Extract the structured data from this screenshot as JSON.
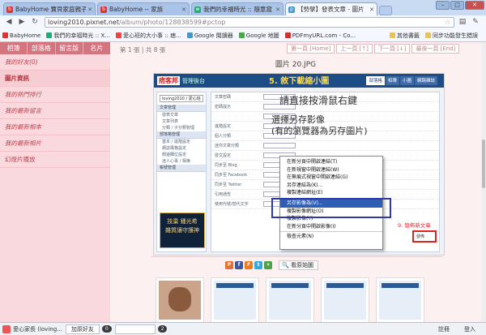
{
  "browser": {
    "tabs": [
      {
        "label": "BabyHome 寶貝家庭親子網",
        "favicon": "b",
        "active": false
      },
      {
        "label": "BabyHome -- 家族",
        "favicon": "b",
        "active": false
      },
      {
        "label": "我們的幸福時光 :: 隨意窩",
        "favicon": "w",
        "active": false
      },
      {
        "label": "【勢擘】發表文章 - 圖片",
        "favicon": "p",
        "active": true
      }
    ],
    "url_host": "loving2010.pixnet.net",
    "url_path": "/album/photo/128838599#pctop",
    "bookmarks": [
      {
        "label": "BabyHome",
        "color": "#d33"
      },
      {
        "label": "我們的幸福時光 :: X...",
        "color": "#2a7"
      },
      {
        "label": "愛心班的大小事 :: 痞...",
        "color": "#e44"
      },
      {
        "label": "Google 閱讀器",
        "color": "#49c"
      },
      {
        "label": "Google 地圖",
        "color": "#4a4"
      },
      {
        "label": "PDFmyURL.com - Co...",
        "color": "#c33"
      }
    ],
    "bookmarks_right": [
      {
        "label": "其他書籤"
      },
      {
        "label": "同步功能發生錯誤"
      }
    ]
  },
  "sidebar": {
    "top_nav": [
      "相簿",
      "部落格",
      "留言版",
      "名片"
    ],
    "items": [
      {
        "label": "我的好友(0)",
        "header": false,
        "italic": true
      },
      {
        "label": "圖片資訊",
        "header": true,
        "italic": false
      },
      {
        "label": "我的熱門排行",
        "header": false,
        "italic": true
      },
      {
        "label": "我的最新留言",
        "header": false,
        "italic": true
      },
      {
        "label": "我的最新相本",
        "header": false,
        "italic": true
      },
      {
        "label": "我的最新相片",
        "header": false,
        "italic": true
      },
      {
        "label": "幻燈片播放",
        "header": false,
        "italic": false
      }
    ]
  },
  "main": {
    "breadcrumb": "第 1 張 | 共 8 張",
    "pager": [
      "第一頁 [Home]",
      "上一頁 [↑]",
      "下一頁 [↓]",
      "最後一頁 [End]"
    ],
    "photo_title": "圖片 20.JPG",
    "photo": {
      "logo": "痞客邦",
      "manage": "管理後台",
      "step5": "5. 敘下載縮小圖",
      "tabs": [
        "部落格",
        "相簿",
        "小圖",
        "網路雜誌"
      ],
      "overlay_line1": "請直接按滑鼠右鍵",
      "overlay_line2": "選擇另存影像",
      "overlay_line3": "(有的瀏覽器為另存圖片)",
      "sidebar_sections": [
        {
          "title": "文章管理",
          "items": [
            "發表文章",
            "文章列表",
            "分類 / 子分類管理"
          ]
        },
        {
          "title": "部落格管理",
          "items": [
            "基本 / 進階設定",
            "網誌風格設定",
            "側邊欄位設定",
            "迷人心事 / 相簿"
          ]
        },
        {
          "title": "帳號管理",
          "items": []
        }
      ],
      "sidebar_select": "loving2010 / 愛心班",
      "form_rows": [
        "文章密碼",
        "密碼提示",
        "",
        "進階設定",
        "個人分類",
        "迷你文章分類",
        "發文設定",
        "同步至 Blog",
        "同步至 Facebook",
        "同步至 Twitter",
        "引用通告",
        "使用代號/替代文字"
      ],
      "ad_lines": [
        "技巢 鍾光希",
        "雜質讓守護神"
      ],
      "context_menu": [
        "在新分頁中開啟連結(T)",
        "在新視窗中開啟連結(W)",
        "在無痕式視窗中開啟連結(G)",
        "另存連結為(K)...",
        "複製連結網址(E)",
        "---",
        "另存影像為(V)...",
        "複製影像網址(O)",
        "複製影像(Y)",
        "在新分頁中開啟影像(I)",
        "---",
        "檢查元素(N)"
      ],
      "highlight_index": 6,
      "step9": "9. 發佈新文章",
      "publish": "發佈"
    },
    "share_icons": [
      {
        "name": "plurk",
        "glyph": "P",
        "color": "#e86f2e"
      },
      {
        "name": "facebook",
        "glyph": "f",
        "color": "#3b5998"
      },
      {
        "name": "funp",
        "glyph": "F",
        "color": "#ef7a1a"
      },
      {
        "name": "twitter",
        "glyph": "t",
        "color": "#35a7e0"
      },
      {
        "name": "share",
        "glyph": "+",
        "color": "#4da04a"
      }
    ],
    "view_original": "看原始圖"
  },
  "statusbar": {
    "user": "愛心家長 (loving...",
    "add_friend": "加原好友",
    "count1": "0",
    "count2": "2",
    "right": [
      "註冊",
      "登入"
    ]
  }
}
